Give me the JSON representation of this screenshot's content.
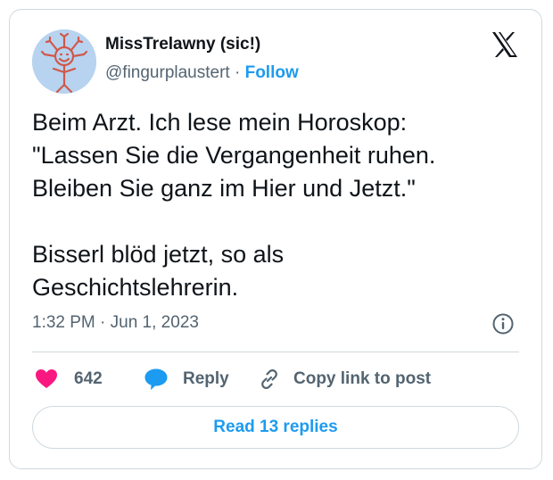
{
  "author": {
    "display_name": "MissTrelawny (sic!)",
    "handle": "@fingurplaustert",
    "separator": "·",
    "follow_label": "Follow",
    "avatar_icon": "hand-drawn-sun-face-avatar"
  },
  "header": {
    "logo_icon": "x-logo-icon"
  },
  "tweet": {
    "lines": [
      "Beim Arzt. Ich lese mein Horoskop:",
      "\"Lassen Sie die Vergangenheit ruhen.",
      "Bleiben Sie ganz im Hier und Jetzt.\"",
      "Bisserl blöd jetzt, so als",
      "Geschichtslehrerin."
    ],
    "timestamp": "1:32 PM · Jun 1, 2023"
  },
  "actions": {
    "like_count": "642",
    "reply_label": "Reply",
    "copy_label": "Copy link to post",
    "read_replies_label": "Read 13 replies"
  },
  "colors": {
    "like": "#f91880",
    "accent": "#1d9bf0",
    "text": "#0f1419",
    "muted": "#536471",
    "border": "#cfd9de"
  }
}
